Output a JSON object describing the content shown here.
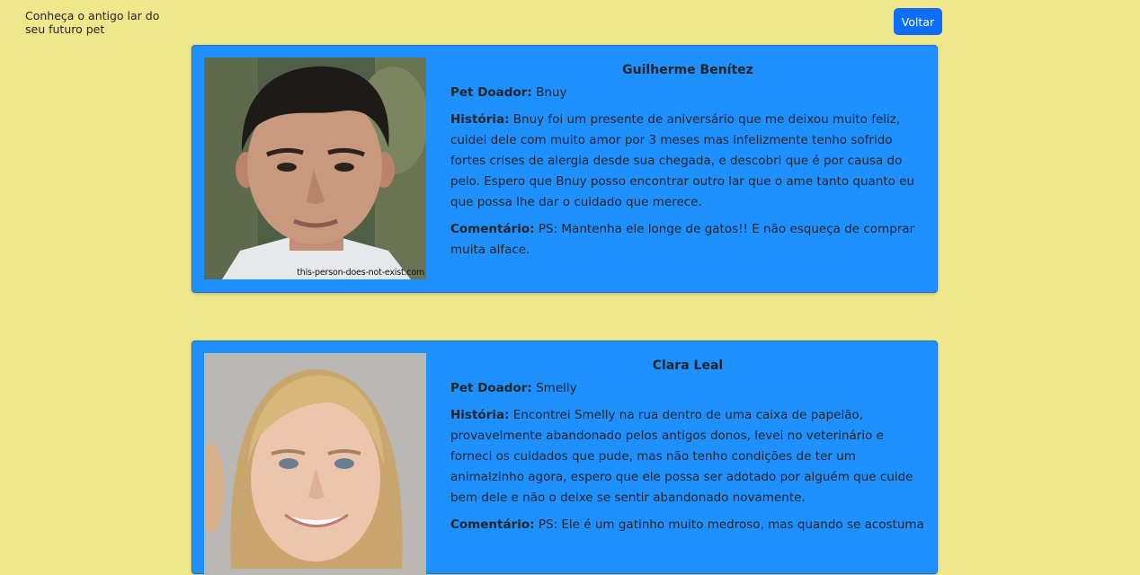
{
  "header": {
    "title": "Conheça o antigo lar do seu futuro pet",
    "back_label": "Voltar"
  },
  "labels": {
    "pet": "Pet Doador:",
    "history": "História:",
    "comment": "Comentário:"
  },
  "cards": [
    {
      "name": "Guilherme Benítez",
      "pet": "Bnuy",
      "history": "Bnuy foi um presente de aniversário que me deixou muito feliz, cuidei dele com muito amor por 3 meses mas infelizmente tenho sofrido fortes crises de alergia desde sua chegada, e descobri que é por causa do pelo. Espero que Bnuy posso encontrar outro lar que o ame tanto quanto eu que possa lhe dar o cuidado que merece.",
      "comment": "PS: Mantenha ele longe de gatos!! E não esqueça de comprar muita alface.",
      "watermark": "this-person-does-not-exist.com"
    },
    {
      "name": "Clara Leal",
      "pet": "Smelly",
      "history": "Encontrei Smelly na rua dentro de uma caixa de papelão, provavelmente abandonado pelos antigos donos, levei no veterinário e forneci os cuidados que pude, mas não tenho condições de ter um animalzinho agora, espero que ele possa ser adotado por alguém que cuide bem dele e não o deixe se sentir abandonado novamente.",
      "comment": "PS: Ele é um gatinho muito medroso, mas quando se acostuma"
    }
  ],
  "colors": {
    "background": "#f0e68c",
    "card": "#1e90ff",
    "button": "#0d6efd"
  }
}
